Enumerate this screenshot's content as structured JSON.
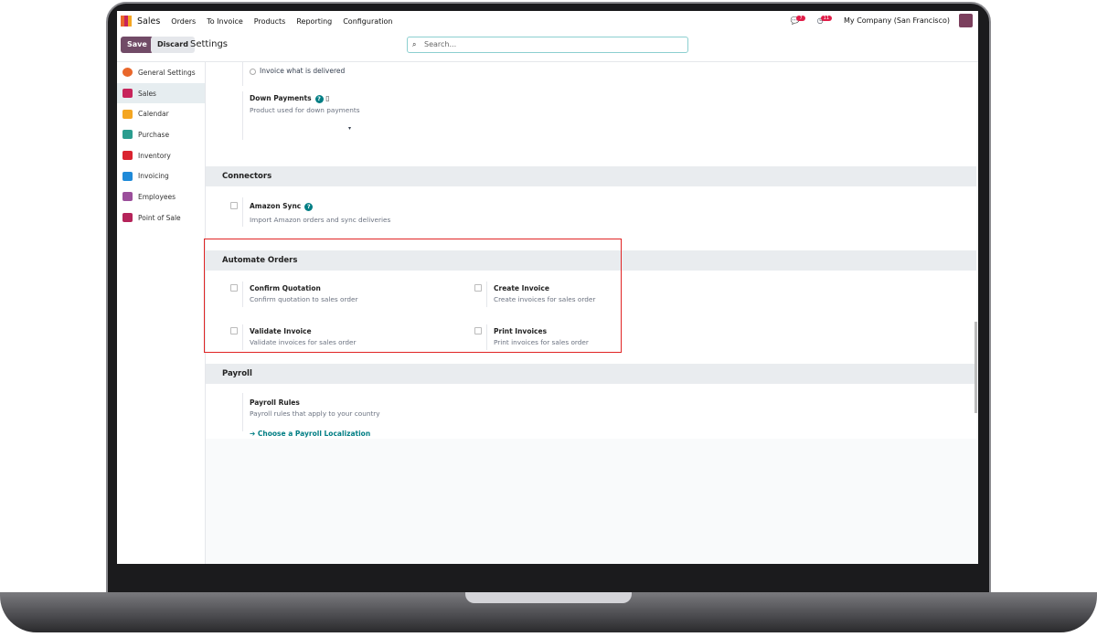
{
  "nav": {
    "app": "Sales",
    "menu": [
      "Orders",
      "To Invoice",
      "Products",
      "Reporting",
      "Configuration"
    ],
    "messages_count": "7",
    "activities_count": "11",
    "company": "My Company (San Francisco)"
  },
  "control": {
    "save": "Save",
    "discard": "Discard",
    "title": "Settings",
    "search_placeholder": "Search..."
  },
  "sidebar": [
    {
      "label": "General Settings",
      "color": "#e9672b"
    },
    {
      "label": "Sales",
      "color": "#c7245a"
    },
    {
      "label": "Calendar",
      "color": "#f4a622"
    },
    {
      "label": "Purchase",
      "color": "#2b9d8f"
    },
    {
      "label": "Inventory",
      "color": "#d9232f"
    },
    {
      "label": "Invoicing",
      "color": "#1f8ad8"
    },
    {
      "label": "Employees",
      "color": "#9b4f9b"
    },
    {
      "label": "Point of Sale",
      "color": "#b5245a"
    }
  ],
  "invoicing": {
    "option": "Invoice what is delivered",
    "down_payments": "Down Payments",
    "down_payments_desc": "Product used for down payments"
  },
  "connectors": {
    "title": "Connectors",
    "amazon": "Amazon Sync",
    "amazon_desc": "Import Amazon orders and sync deliveries"
  },
  "automate": {
    "title": "Automate Orders",
    "items": [
      {
        "label": "Confirm Quotation",
        "desc": "Confirm quotation to sales order"
      },
      {
        "label": "Create Invoice",
        "desc": "Create invoices for sales order"
      },
      {
        "label": "Validate Invoice",
        "desc": "Validate invoices for sales order"
      },
      {
        "label": "Print Invoices",
        "desc": "Print invoices for sales order"
      }
    ]
  },
  "payroll": {
    "title": "Payroll",
    "rules": "Payroll Rules",
    "rules_desc": "Payroll rules that apply to your country",
    "link": "Choose a Payroll Localization"
  }
}
